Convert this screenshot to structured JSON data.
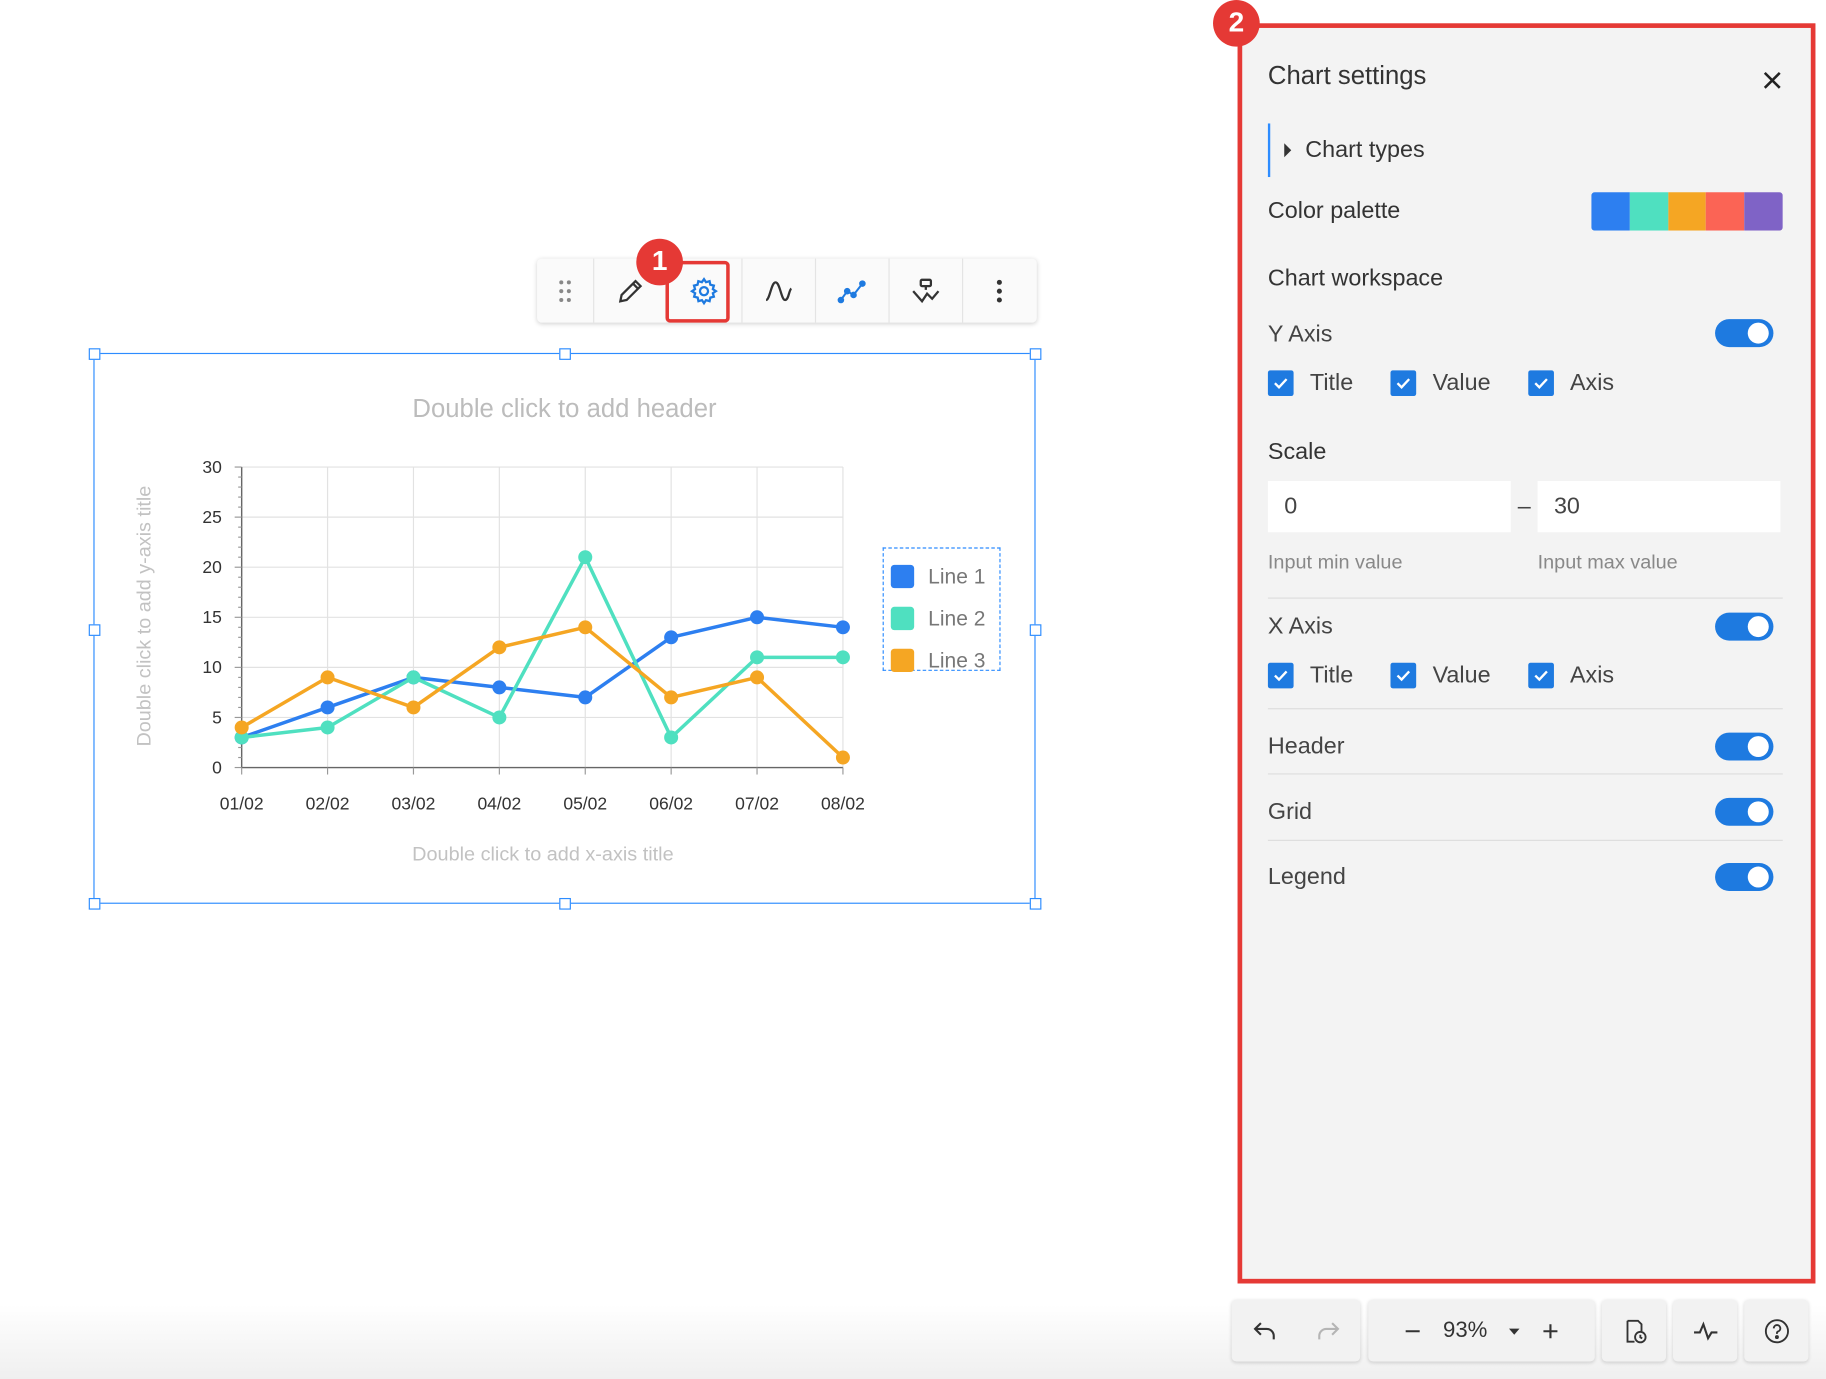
{
  "toolbar": {
    "items": [
      "drag-handle",
      "edit",
      "settings",
      "curve",
      "line-chart",
      "annotation",
      "more"
    ],
    "badge": "1"
  },
  "chart": {
    "header_placeholder": "Double click to add header",
    "x_title_placeholder": "Double click to add x-axis title",
    "y_title_placeholder": "Double click to add y-axis title"
  },
  "chart_data": {
    "type": "line",
    "title": "",
    "xlabel": "",
    "ylabel": "",
    "categories": [
      "01/02",
      "02/02",
      "03/02",
      "04/02",
      "05/02",
      "06/02",
      "07/02",
      "08/02"
    ],
    "ylim": [
      0,
      30
    ],
    "yticks": [
      0,
      5,
      10,
      15,
      20,
      25,
      30
    ],
    "grid": true,
    "legend": "right",
    "series": [
      {
        "name": "Line 1",
        "color": "#2d7ff0",
        "values": [
          3,
          6,
          9,
          8,
          7,
          13,
          15,
          14
        ]
      },
      {
        "name": "Line 2",
        "color": "#4fe0c0",
        "values": [
          3,
          4,
          9,
          5,
          21,
          3,
          11,
          11
        ]
      },
      {
        "name": "Line 3",
        "color": "#f5a623",
        "values": [
          4,
          9,
          6,
          12,
          14,
          7,
          9,
          1
        ]
      }
    ]
  },
  "settings": {
    "badge": "2",
    "title": "Chart settings",
    "chart_types": "Chart types",
    "color_palette_label": "Color palette",
    "palette": [
      "#2d7ff0",
      "#4fe0c0",
      "#f5a623",
      "#fb6455",
      "#7f63c6"
    ],
    "workspace_label": "Chart workspace",
    "y_axis": {
      "label": "Y Axis",
      "enabled": true,
      "checks": [
        "Title",
        "Value",
        "Axis"
      ]
    },
    "scale": {
      "label": "Scale",
      "min": "0",
      "max": "30",
      "dash": "–",
      "min_hint": "Input min value",
      "max_hint": "Input max value"
    },
    "x_axis": {
      "label": "X Axis",
      "enabled": true,
      "checks": [
        "Title",
        "Value",
        "Axis"
      ]
    },
    "header": {
      "label": "Header",
      "enabled": true
    },
    "grid": {
      "label": "Grid",
      "enabled": true
    },
    "legend": {
      "label": "Legend",
      "enabled": true
    }
  },
  "bottom_bar": {
    "zoom": "93%"
  }
}
